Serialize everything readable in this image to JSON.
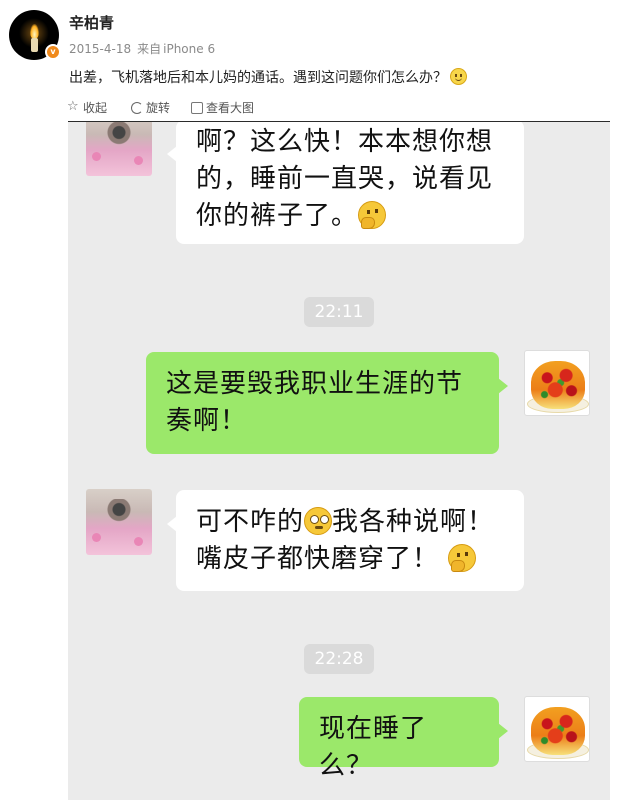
{
  "post": {
    "username": "辛柏青",
    "date": "2015-4-18",
    "source_prefix": "来自",
    "source": "iPhone 6",
    "text": "出差，飞机落地后和本儿妈的通话。遇到这问题你们怎么办？",
    "text_emoji": "smile-icon"
  },
  "actions": {
    "collect": "收起",
    "rotate": "旋转",
    "view": "查看大图"
  },
  "chat": {
    "messages": [
      {
        "side": "left",
        "line1": "啊？这么快！本本想你想",
        "line2": "的，睡前一直哭，说看见",
        "line3": "你的裤子了。",
        "emoji": "thinking-face"
      },
      {
        "side": "right",
        "line1": "这是要毁我职业生涯的节",
        "line2": "奏啊！"
      },
      {
        "side": "left",
        "line1a": "可不咋的",
        "line1b": "我各种说啊！",
        "line2": "嘴皮子都快磨穿了！",
        "emoji": "thinking-face"
      },
      {
        "side": "right",
        "line1": "现在睡了么？"
      }
    ],
    "times": [
      "22:11",
      "22:28"
    ]
  },
  "colors": {
    "chat_bg": "#ebebeb",
    "bubble_sent": "#9be86a",
    "bubble_received": "#ffffff",
    "verified_badge": "#f08a1c"
  }
}
